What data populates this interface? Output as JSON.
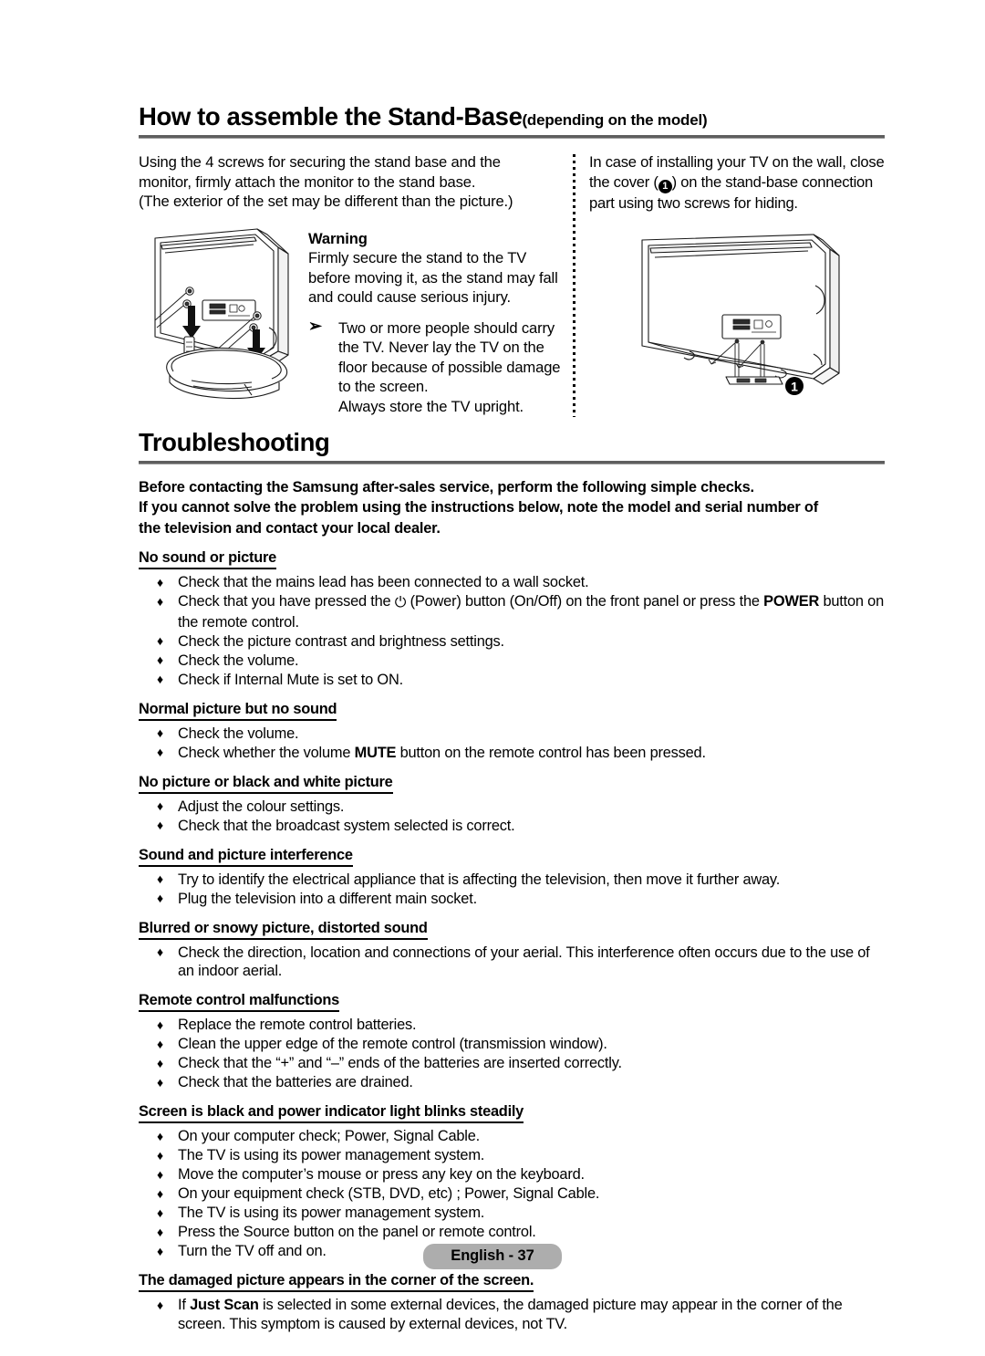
{
  "page": {
    "footer_label": "English - 37",
    "accent_rule_color": "#5e5e5e",
    "footer_pill_color": "#adadad"
  },
  "stand_section": {
    "heading_main": "How to assemble the Stand-Base",
    "heading_sub": "(depending on the model)",
    "left_column": {
      "paragraph_line1": "Using the 4 screws for securing the stand base and the",
      "paragraph_line2": "monitor, firmly attach the monitor to the stand base.",
      "paragraph_line3": "(The exterior of the set may be different than the picture.)",
      "warning_title": "Warning",
      "warning_body": "Firmly secure the stand to the TV before moving it, as the stand may fall and could cause serious injury.",
      "note_bullet_glyph": "➢",
      "note_body": "Two or more people should carry the TV. Never lay the TV on the floor because of possible damage to the screen.",
      "note_body_last": "Always store the TV upright.",
      "illustration_name": "tv-stand-assembly-diagram"
    },
    "right_column": {
      "paragraph_part1": "In case of installing your TV on the wall, close the cover (",
      "callout_number": "1",
      "paragraph_part2": ") on the stand-base connection part using two screws for hiding.",
      "illustration_name": "tv-rear-cover-diagram",
      "illustration_callout": "1"
    }
  },
  "troubleshooting": {
    "heading": "Troubleshooting",
    "intro_line1": "Before contacting the Samsung after-sales service, perform the following simple checks.",
    "intro_line2": "If you cannot solve the problem using the instructions below, note the model and serial number of",
    "intro_line3": "the television and contact your local dealer.",
    "bullet_glyph": "♦",
    "sections": [
      {
        "title": "No sound or picture",
        "items": [
          "Check that the mains lead has been connected to a wall socket.",
          "Check that you have pressed the ⏻ (Power) button (On/Off) on the front panel or press the POWER button on the remote control.",
          "Check the picture contrast and brightness settings.",
          "Check the volume.",
          "Check if Internal Mute is set to ON."
        ]
      },
      {
        "title": "Normal picture but no sound",
        "items": [
          "Check the volume.",
          "Check whether the volume MUTE button on the remote control has been pressed."
        ]
      },
      {
        "title": "No picture or black and white picture",
        "items": [
          "Adjust the colour settings.",
          "Check that the broadcast system selected is correct."
        ]
      },
      {
        "title": "Sound and picture interference",
        "items": [
          "Try to identify the electrical appliance that is affecting the television, then move it further away.",
          "Plug the television into a different main socket."
        ]
      },
      {
        "title": "Blurred or snowy picture, distorted sound",
        "items": [
          "Check the direction, location and connections of your aerial. This interference often occurs due to the use of an indoor aerial."
        ]
      },
      {
        "title": "Remote control malfunctions",
        "items": [
          "Replace the remote control batteries.",
          "Clean the upper edge of the remote control (transmission window).",
          "Check that the “+” and “–” ends of the batteries are inserted correctly.",
          "Check that the batteries are drained."
        ]
      },
      {
        "title": "Screen is black and power indicator light blinks steadily",
        "items": [
          "On your computer check; Power, Signal Cable.",
          "The TV is using its power management system.",
          "Move the computer’s mouse or press any key on the keyboard.",
          "On your equipment check (STB, DVD, etc) ; Power, Signal Cable.",
          "The TV is using its power management system.",
          "Press the Source button on the panel or remote control.",
          "Turn the TV off and on."
        ]
      },
      {
        "title": "The damaged picture appears in the corner of the screen.",
        "items": [
          "If Just Scan is selected in some external devices, the damaged picture may appear in the corner of the screen. This symptom is caused by external devices, not TV."
        ]
      }
    ]
  }
}
